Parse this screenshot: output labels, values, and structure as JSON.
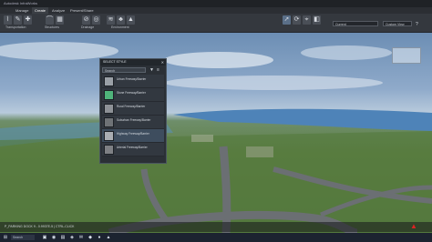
{
  "app": {
    "title": "Autodesk InfraWorks"
  },
  "ribbon_tabs": [
    "Manage",
    "Create",
    "Analyze",
    "Present/Share"
  ],
  "ribbon_groups": [
    "Transportation",
    "Structures",
    "Drainage",
    "Environment"
  ],
  "view": {
    "dropdown_value": "Current",
    "style_button": "Custom View"
  },
  "dialog": {
    "title": "SELECT STYLE",
    "search_placeholder": "Search",
    "items": [
      {
        "label": "Urban Freeway/Barrier",
        "color": "#9aa0a6"
      },
      {
        "label": "Stone Freeway/Barrier",
        "color": "#4fb37a"
      },
      {
        "label": "Rural Freeway/Barrier",
        "color": "#8d9196"
      },
      {
        "label": "Suburban Freeway/Barrier",
        "color": "#6e7276"
      },
      {
        "label": "Highway Freeway/Barrier",
        "color": "#a9adb2",
        "selected": true
      },
      {
        "label": "Arterial Freeway/Barrier",
        "color": "#7e8084"
      }
    ]
  },
  "status_text": "P_PARKING DOCK 9 - 0.9937E-5 | CTRL-CLICK",
  "taskbar": {
    "search": "Search"
  }
}
